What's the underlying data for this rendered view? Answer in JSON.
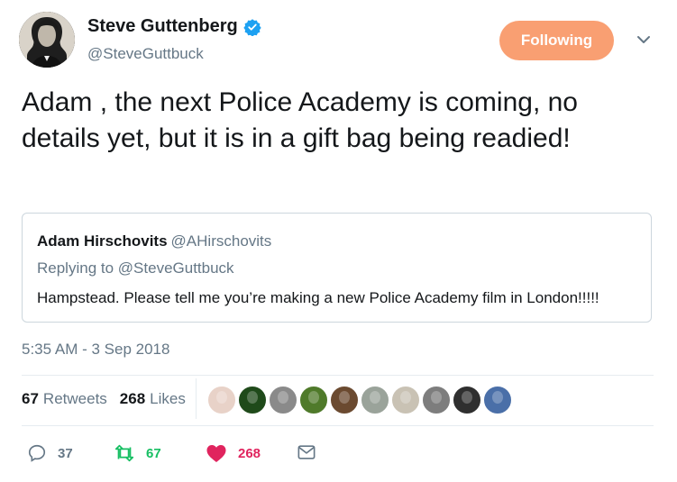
{
  "author": {
    "name": "Steve Guttenberg",
    "handle": "@SteveGuttbuck",
    "verified_icon": "verified-badge-icon",
    "avatar": "avatar-photo"
  },
  "follow_button": {
    "label": "Following",
    "color": "#f99f72"
  },
  "menu_icon": "chevron-down-icon",
  "tweet": {
    "text": "Adam , the next Police Academy is coming, no details yet, but it is in a gift bag being readied!"
  },
  "quote": {
    "name": "Adam Hirschovits",
    "handle": "@AHirschovits",
    "replying_prefix": "Replying to",
    "replying_to": "@SteveGuttbuck",
    "text": "Hampstead. Please tell me you’re making a new Police Academy film in London!!!!!"
  },
  "timestamp": "5:35 AM - 3 Sep 2018",
  "stats": {
    "retweets_count": "67",
    "retweets_label": "Retweets",
    "likes_count": "268",
    "likes_label": "Likes"
  },
  "likers": [
    {
      "name": "liker-avatar-1",
      "color": "#e8d2c8"
    },
    {
      "name": "liker-avatar-2",
      "color": "#1f4a1a"
    },
    {
      "name": "liker-avatar-3",
      "color": "#8a8a8a"
    },
    {
      "name": "liker-avatar-4",
      "color": "#4f7a2a"
    },
    {
      "name": "liker-avatar-5",
      "color": "#6b4a30"
    },
    {
      "name": "liker-avatar-6",
      "color": "#9aa39a"
    },
    {
      "name": "liker-avatar-7",
      "color": "#c9c2b4"
    },
    {
      "name": "liker-avatar-8",
      "color": "#7d7d7d"
    },
    {
      "name": "liker-avatar-9",
      "color": "#2f2f2f"
    },
    {
      "name": "liker-avatar-10",
      "color": "#4a6fa8"
    }
  ],
  "actions": {
    "reply_count": "37",
    "retweet_count": "67",
    "like_count": "268",
    "reply_icon": "reply-icon",
    "retweet_icon": "retweet-icon",
    "like_icon": "heart-icon",
    "dm_icon": "envelope-icon",
    "reply_color": "#657786",
    "retweet_color": "#17bf63",
    "like_color": "#e0245e"
  }
}
